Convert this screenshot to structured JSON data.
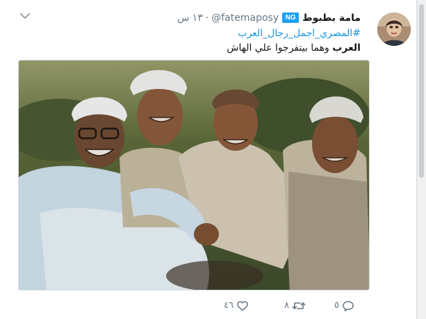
{
  "tweet": {
    "display_name": "مامة بطبوط",
    "verified_badge": "NG",
    "username": "@fatemaposy",
    "dot": "·",
    "timestamp": "١٣ س",
    "hashtag": "#المصري_اجمل_رجال_العرب",
    "text_bold": "العرب",
    "text_rest": " وهما بيتفرجوا علي الهاش",
    "media_alt": "photo of four smiling men"
  },
  "actions": {
    "reply_count": "٥",
    "retweet_count": "٨",
    "like_count": "٤٦"
  },
  "icons": {
    "dismiss": "chevron-down-icon",
    "reply": "reply-icon",
    "retweet": "retweet-icon",
    "like": "heart-icon"
  },
  "colors": {
    "link": "#1b95e0",
    "text": "#14171a",
    "secondary": "#657786",
    "verified": "#1da1f2",
    "background": "#e6ecf0"
  }
}
